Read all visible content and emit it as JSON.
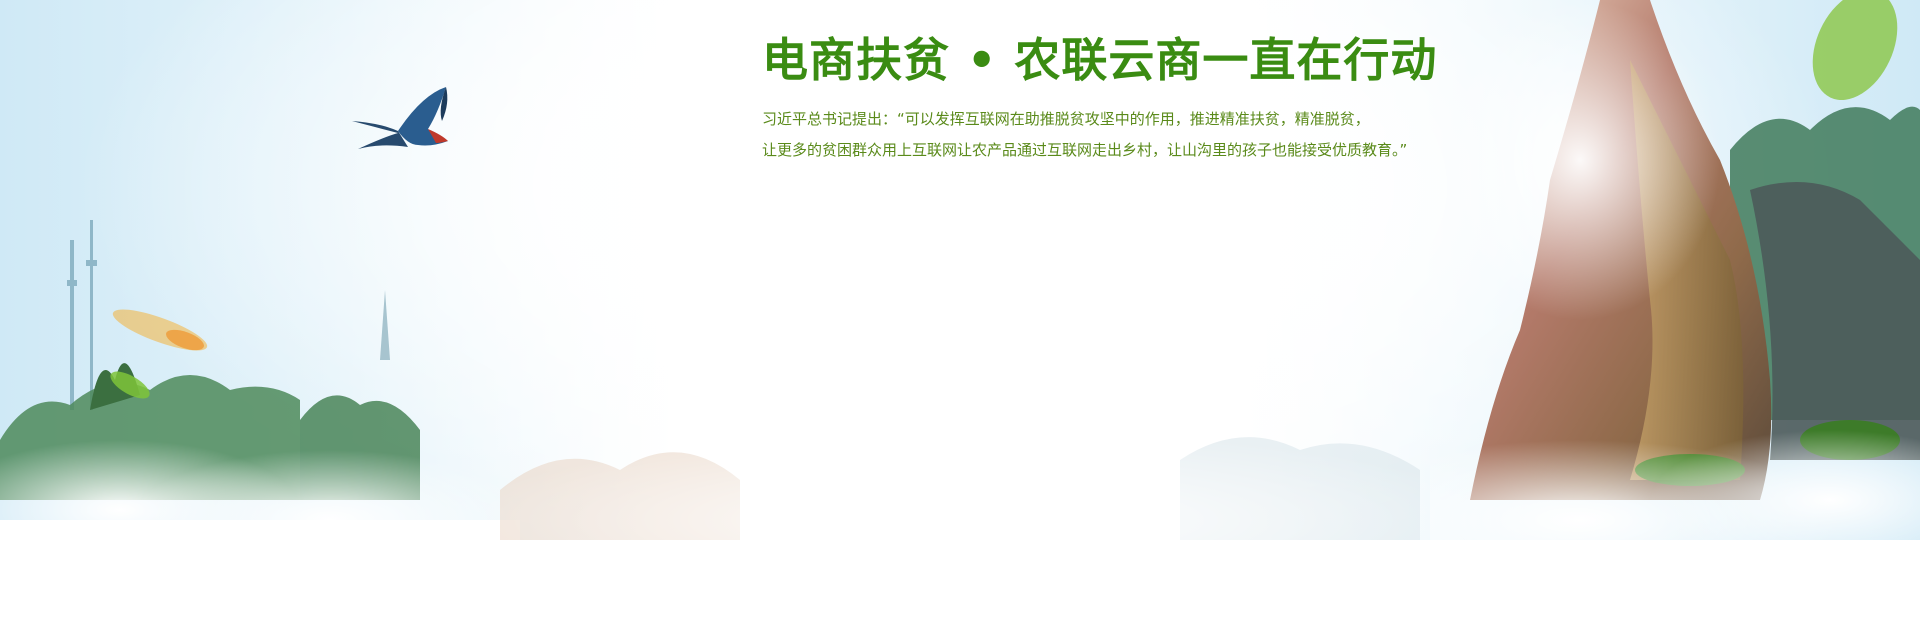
{
  "banner": {
    "title": "电商扶贫 • 农联云商一直在行动",
    "quote_line_1": "习近平总书记提出：“可以发挥互联网在助推脱贫攻坚中的作用，推进精准扶贫，精准脱贫，",
    "quote_line_2": "让更多的贫困群众用上互联网让农产品通过互联网走出乡村，让山沟里的孩子也能接受优质教育。”"
  },
  "colors": {
    "title_green": "#3a8c12",
    "quote_green": "#5a8a1a"
  },
  "icons": {
    "bird": "swallow-icon",
    "leaf": "leaf-icon"
  }
}
